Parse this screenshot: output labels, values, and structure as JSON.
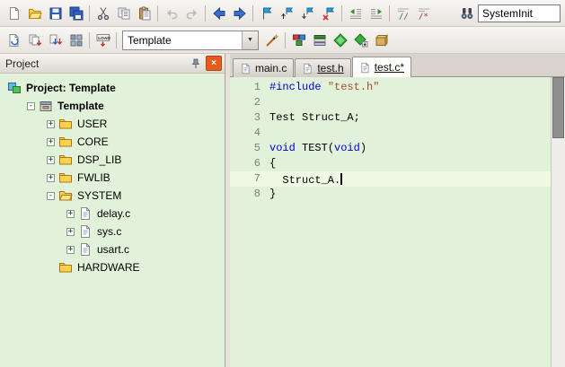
{
  "colors": {
    "editor_bg": "#e2f1da",
    "current_line_bg": "#eefae3",
    "line_number": "#78827a",
    "keyword": "#0000cc",
    "string": "#a0522d",
    "plain": "#000000",
    "close_button_bg": "#e65c1e"
  },
  "glyphs": {
    "combo_arrow": "▼",
    "close": "×",
    "expander_plus": "+",
    "expander_minus": "-"
  },
  "file_toolbar": {
    "items": [
      {
        "type": "icon",
        "icon": "new-file"
      },
      {
        "type": "icon",
        "icon": "open-folder"
      },
      {
        "type": "icon",
        "icon": "save"
      },
      {
        "type": "icon",
        "icon": "save-all"
      },
      {
        "type": "sep"
      },
      {
        "type": "icon",
        "icon": "cut"
      },
      {
        "type": "icon",
        "icon": "copy"
      },
      {
        "type": "icon",
        "icon": "paste"
      },
      {
        "type": "sep"
      },
      {
        "type": "icon",
        "icon": "undo",
        "disabled": true
      },
      {
        "type": "icon",
        "icon": "redo",
        "disabled": true
      },
      {
        "type": "sep"
      },
      {
        "type": "icon",
        "icon": "nav-back"
      },
      {
        "type": "icon",
        "icon": "nav-forward"
      },
      {
        "type": "sep"
      },
      {
        "type": "icon",
        "icon": "bookmark"
      },
      {
        "type": "icon",
        "icon": "bookmark-prev"
      },
      {
        "type": "icon",
        "icon": "bookmark-next"
      },
      {
        "type": "icon",
        "icon": "bookmark-clear"
      },
      {
        "type": "sep"
      },
      {
        "type": "icon",
        "icon": "indent-left"
      },
      {
        "type": "icon",
        "icon": "indent-right"
      },
      {
        "type": "sep"
      },
      {
        "type": "icon",
        "icon": "comment"
      },
      {
        "type": "icon",
        "icon": "uncomment"
      },
      {
        "type": "spacer"
      },
      {
        "type": "icon",
        "icon": "find-in-files"
      },
      {
        "type": "editbox",
        "name": "find-input",
        "value": "SystemInit"
      }
    ]
  },
  "build_toolbar": {
    "items": [
      {
        "type": "icon",
        "icon": "translate"
      },
      {
        "type": "icon",
        "icon": "build"
      },
      {
        "type": "icon",
        "icon": "rebuild"
      },
      {
        "type": "icon",
        "icon": "batch-build"
      },
      {
        "type": "sep"
      },
      {
        "type": "icon",
        "icon": "load"
      },
      {
        "type": "sep"
      },
      {
        "type": "combo",
        "name": "target-combobox",
        "value": "Template"
      },
      {
        "type": "icon",
        "icon": "options-for-target"
      },
      {
        "type": "sep"
      },
      {
        "type": "icon",
        "icon": "manage-project-items"
      },
      {
        "type": "icon",
        "icon": "manage-books"
      },
      {
        "type": "icon",
        "icon": "manage-rte"
      },
      {
        "type": "icon",
        "icon": "pack-installer"
      },
      {
        "type": "icon",
        "icon": "component-viewer"
      }
    ]
  },
  "project_panel": {
    "header": {
      "title": "Project"
    },
    "tree": [
      {
        "label": "Project: Template",
        "level": 0,
        "icon": "project",
        "expander": "none",
        "bold": true
      },
      {
        "label": "Template",
        "level": 1,
        "icon": "target",
        "expander": "minus",
        "bold": true
      },
      {
        "label": "USER",
        "level": 2,
        "icon": "folder",
        "expander": "plus",
        "bold": false
      },
      {
        "label": "CORE",
        "level": 2,
        "icon": "folder",
        "expander": "plus",
        "bold": false
      },
      {
        "label": "DSP_LIB",
        "level": 2,
        "icon": "folder",
        "expander": "plus",
        "bold": false
      },
      {
        "label": "FWLIB",
        "level": 2,
        "icon": "folder",
        "expander": "plus",
        "bold": false
      },
      {
        "label": "SYSTEM",
        "level": 2,
        "icon": "folder-open",
        "expander": "minus",
        "bold": false
      },
      {
        "label": "delay.c",
        "level": 3,
        "icon": "file",
        "expander": "plus",
        "bold": false
      },
      {
        "label": "sys.c",
        "level": 3,
        "icon": "file",
        "expander": "plus",
        "bold": false
      },
      {
        "label": "usart.c",
        "level": 3,
        "icon": "file",
        "expander": "plus",
        "bold": false
      },
      {
        "label": "HARDWARE",
        "level": 2,
        "icon": "folder",
        "expander": "none",
        "bold": false
      }
    ]
  },
  "editor": {
    "tabs": [
      {
        "label": "main.c",
        "active": false,
        "underline": false
      },
      {
        "label": "test.h",
        "active": false,
        "underline": true
      },
      {
        "label": "test.c*",
        "active": true,
        "underline": true
      }
    ],
    "lines": [
      {
        "n": "1",
        "segments": [
          {
            "t": "#include ",
            "c": "keyword"
          },
          {
            "t": "\"test.h\"",
            "c": "string"
          }
        ]
      },
      {
        "n": "2",
        "segments": []
      },
      {
        "n": "3",
        "segments": [
          {
            "t": "Test Struct_A;",
            "c": "plain"
          }
        ]
      },
      {
        "n": "4",
        "segments": []
      },
      {
        "n": "5",
        "segments": [
          {
            "t": "void ",
            "c": "keyword"
          },
          {
            "t": "TEST(",
            "c": "plain"
          },
          {
            "t": "void",
            "c": "keyword"
          },
          {
            "t": ")",
            "c": "plain"
          }
        ]
      },
      {
        "n": "6",
        "segments": [
          {
            "t": "{",
            "c": "plain"
          }
        ]
      },
      {
        "n": "7",
        "segments": [
          {
            "t": "  Struct_A.",
            "c": "plain"
          }
        ],
        "current": true,
        "caret": true
      },
      {
        "n": "8",
        "segments": [
          {
            "t": "}",
            "c": "plain"
          }
        ]
      }
    ]
  }
}
